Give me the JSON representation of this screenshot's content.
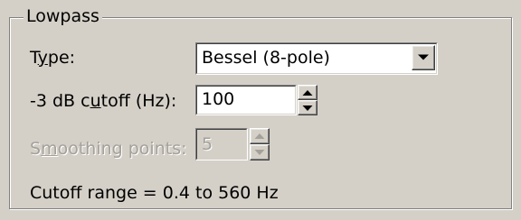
{
  "group": {
    "title": "Lowpass"
  },
  "type": {
    "label_pre": "T",
    "label_ul": "y",
    "label_post": "pe:",
    "value": "Bessel (8-pole)",
    "dropdown_icon": "chevron-down-icon"
  },
  "cutoff": {
    "label_pre": "-3 dB c",
    "label_ul": "u",
    "label_post": "toff (Hz):",
    "value": "100",
    "spinner_icon": "spinner-icon"
  },
  "smoothing": {
    "label_pre": "S",
    "label_ul": "m",
    "label_post": "oothing points:",
    "value": "5",
    "enabled": false,
    "spinner_icon": "spinner-icon"
  },
  "range_text": "Cutoff range = 0.4 to 560 Hz",
  "colors": {
    "face": "#d4d0c8",
    "disabled_text": "#a4a09a"
  }
}
